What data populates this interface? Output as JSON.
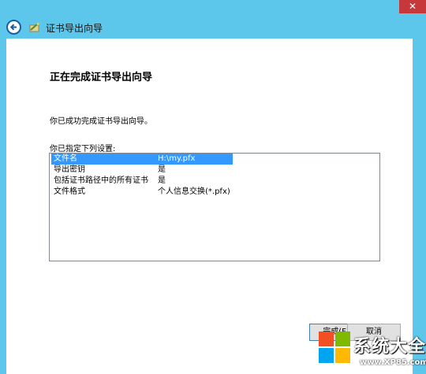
{
  "window": {
    "close_label": "✕",
    "title": "证书导出向导"
  },
  "page": {
    "heading": "正在完成证书导出向导",
    "success_text": "你已成功完成证书导出向导。",
    "settings_label": "你已指定下列设置:"
  },
  "settings": [
    {
      "name": "文件名",
      "value": "H:\\my.pfx"
    },
    {
      "name": "导出密钥",
      "value": "是"
    },
    {
      "name": "包括证书路径中的所有证书",
      "value": "是"
    },
    {
      "name": "文件格式",
      "value": "个人信息交换(*.pfx)"
    }
  ],
  "buttons": {
    "finish": "完成(F)",
    "cancel": "取消"
  },
  "watermark": {
    "text": "系统大全",
    "url": "www.XP85.com"
  },
  "colors": {
    "background": "#5cc7ea",
    "selection": "#3399ff",
    "close": "#c7383a"
  }
}
